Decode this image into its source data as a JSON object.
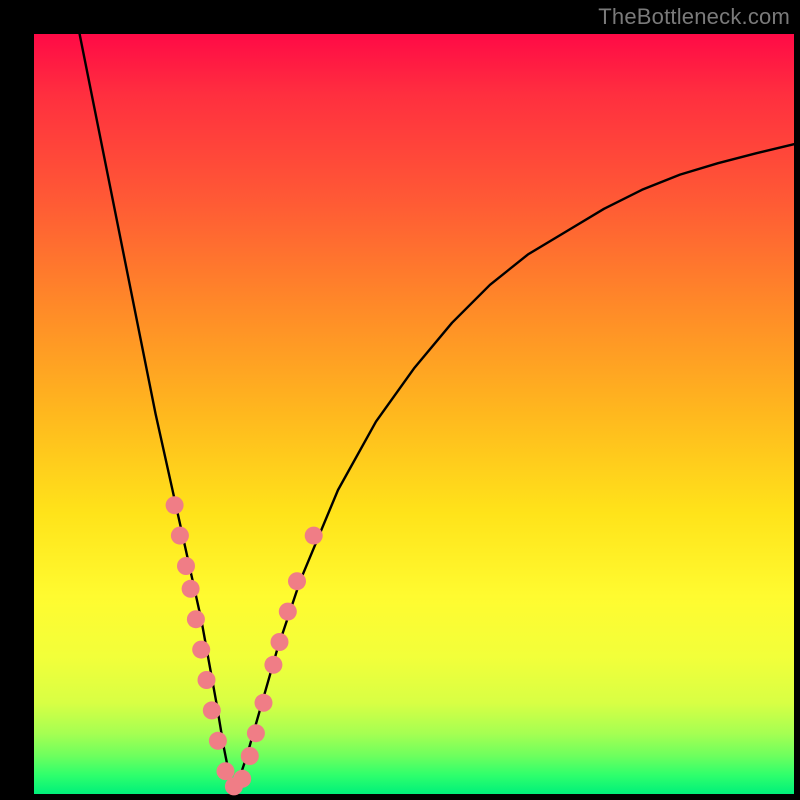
{
  "watermark": "TheBottleneck.com",
  "colors": {
    "frame": "#000000",
    "curve": "#000000",
    "dot": "#f07d86"
  },
  "chart_data": {
    "type": "line",
    "title": "",
    "xlabel": "",
    "ylabel": "",
    "xlim": [
      0,
      100
    ],
    "ylim": [
      0,
      100
    ],
    "grid": false,
    "curve": {
      "comment": "V-shaped bottleneck curve; y ≈ bottleneck% (100=top red, 0=bottom green). Minimum at x≈26.",
      "x": [
        6,
        8,
        10,
        12,
        14,
        16,
        18,
        20,
        22,
        24,
        25,
        26,
        27,
        28,
        30,
        32,
        35,
        40,
        45,
        50,
        55,
        60,
        65,
        70,
        75,
        80,
        85,
        90,
        95,
        100
      ],
      "y": [
        100,
        90,
        80,
        70,
        60,
        50,
        41,
        32,
        23,
        12,
        6,
        1,
        2,
        5,
        12,
        19,
        28,
        40,
        49,
        56,
        62,
        67,
        71,
        74,
        77,
        79.5,
        81.5,
        83,
        84.3,
        85.5
      ]
    },
    "dots": {
      "comment": "Sample markers clustered near the trough on both arms.",
      "points": [
        {
          "x": 18.5,
          "y": 38
        },
        {
          "x": 19.2,
          "y": 34
        },
        {
          "x": 20.0,
          "y": 30
        },
        {
          "x": 20.6,
          "y": 27
        },
        {
          "x": 21.3,
          "y": 23
        },
        {
          "x": 22.0,
          "y": 19
        },
        {
          "x": 22.7,
          "y": 15
        },
        {
          "x": 23.4,
          "y": 11
        },
        {
          "x": 24.2,
          "y": 7
        },
        {
          "x": 25.2,
          "y": 3
        },
        {
          "x": 26.3,
          "y": 1
        },
        {
          "x": 27.4,
          "y": 2
        },
        {
          "x": 28.4,
          "y": 5
        },
        {
          "x": 29.2,
          "y": 8
        },
        {
          "x": 30.2,
          "y": 12
        },
        {
          "x": 31.5,
          "y": 17
        },
        {
          "x": 32.3,
          "y": 20
        },
        {
          "x": 33.4,
          "y": 24
        },
        {
          "x": 34.6,
          "y": 28
        },
        {
          "x": 36.8,
          "y": 34
        }
      ],
      "radius_px": 9
    }
  }
}
